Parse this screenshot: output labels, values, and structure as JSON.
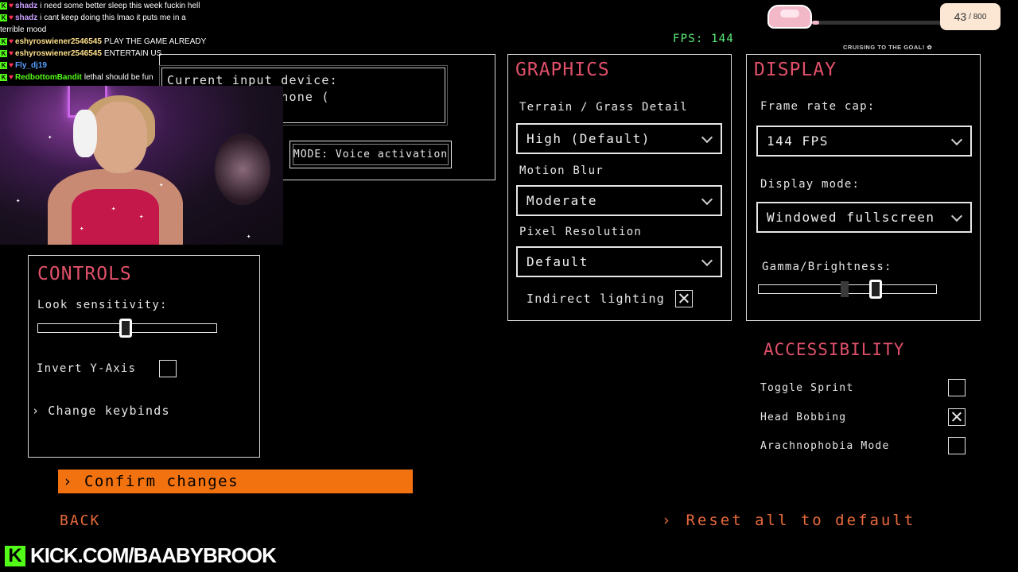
{
  "fps_text": "FPS: 144",
  "input": {
    "label": "Current input device:",
    "device": "Sonar - Microphone (",
    "mode": "MODE: Voice activation"
  },
  "graphics": {
    "heading": "GRAPHICS",
    "terrain_label": "Terrain / Grass Detail",
    "terrain_value": "High (Default)",
    "motion_blur_label": "Motion Blur",
    "motion_blur_value": "Moderate",
    "pixel_res_label": "Pixel Resolution",
    "pixel_res_value": "Default",
    "indirect_lighting_label": "Indirect lighting",
    "indirect_lighting_checked": true
  },
  "display": {
    "heading": "DISPLAY",
    "frame_cap_label": "Frame rate cap:",
    "frame_cap_value": "144 FPS",
    "display_mode_label": "Display mode:",
    "display_mode_value": "Windowed fullscreen",
    "gamma_label": "Gamma/Brightness:",
    "gamma_level": 0.66
  },
  "controls": {
    "heading": "CONTROLS",
    "look_sensitivity_label": "Look sensitivity:",
    "look_sensitivity_level": 0.49,
    "invert_y_label": "Invert Y-Axis",
    "invert_y_checked": false,
    "change_keybinds_label": "Change keybinds"
  },
  "accessibility": {
    "heading": "ACCESSIBILITY",
    "items": [
      {
        "label": "Toggle Sprint",
        "checked": false
      },
      {
        "label": "Head Bobbing",
        "checked": true
      },
      {
        "label": "Arachnophobia Mode",
        "checked": false
      }
    ]
  },
  "actions": {
    "confirm": "Confirm changes",
    "back": "BACK",
    "reset": "Reset all to default"
  },
  "stream": {
    "chat": [
      {
        "name": "shadz",
        "name_color": "#c9a0ff",
        "text": "i need some better sleep this week fuckin hell"
      },
      {
        "name": "shadz",
        "name_color": "#c9a0ff",
        "text": "i cant keep doing this lmao it puts me in a"
      },
      {
        "name": "",
        "name_color": "#ffffff",
        "text": "terrible mood"
      },
      {
        "name": "eshyroswiener2546545",
        "name_color": "#ffe08a",
        "text": "PLAY THE GAME ALREADY"
      },
      {
        "name": "eshyroswiener2546545",
        "name_color": "#ffe08a",
        "text": "ENTERTAIN US"
      },
      {
        "name": "Fly_dj19",
        "name_color": "#5aa0ff",
        "text": ""
      },
      {
        "name": "RedbottomBandit",
        "name_color": "#53fc18",
        "text": "lethal should be fun"
      }
    ],
    "goal_current": "43",
    "goal_total": "/ 800",
    "goal_progress": 0.054,
    "goal_caption": "CRUISING TO THE GOAL! ✿",
    "kick_logo": "K",
    "kick_url": "KICK.COM/BAABYBROOK"
  }
}
